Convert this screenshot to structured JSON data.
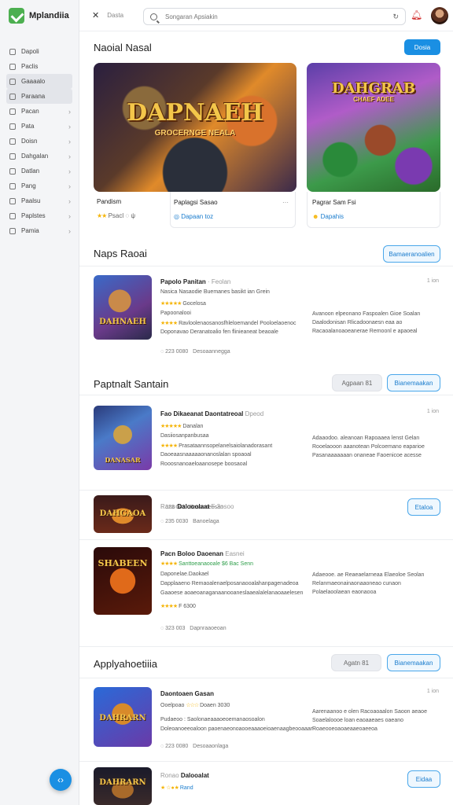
{
  "app": {
    "name": "Mplandiia"
  },
  "sidebar": {
    "items": [
      {
        "label": "Dapoli",
        "chevron": false,
        "active": false
      },
      {
        "label": "Paclis",
        "chevron": false,
        "active": false
      },
      {
        "label": "Gaaaalo",
        "chevron": false,
        "active": true
      },
      {
        "label": "Paraana",
        "chevron": false,
        "active": true
      },
      {
        "label": "Pacan",
        "chevron": true,
        "active": false
      },
      {
        "label": "Pata",
        "chevron": true,
        "active": false
      },
      {
        "label": "Doisn",
        "chevron": true,
        "active": false
      },
      {
        "label": "Dahgalan",
        "chevron": true,
        "active": false
      },
      {
        "label": "Datlan",
        "chevron": true,
        "active": false
      },
      {
        "label": "Pang",
        "chevron": true,
        "active": false
      },
      {
        "label": "Paalsu",
        "chevron": true,
        "active": false
      },
      {
        "label": "Paplstes",
        "chevron": true,
        "active": false
      },
      {
        "label": "Pamia",
        "chevron": true,
        "active": false
      }
    ]
  },
  "topbar": {
    "tab": "Dasta",
    "search_placeholder": "Songaran Apsiakin"
  },
  "featured": {
    "title": "Naoial Nasal",
    "action": "Dosia",
    "cards": [
      {
        "art_title": "DAPNAEH",
        "art_subtitle": "GROCERNGE NEALA",
        "name": "Pandism",
        "sub": "Psacl",
        "more": "ψ",
        "rating": "★★"
      },
      {
        "art_title": "DAHGRAB",
        "art_subtitle": "",
        "name": "Paplagsi Sasao",
        "sub": "Dapaan toz",
        "more": "⋯",
        "rating": ""
      },
      {
        "art_title": "DAHGRAB",
        "art_subtitle": "CHAEF ADEE",
        "name": "Pagrar Sam Fsi",
        "sub": "Dapahis",
        "more": "",
        "rating": ""
      }
    ]
  },
  "section1": {
    "title": "Naps Raoai",
    "action": "Bamaeranoalien",
    "rows": [
      {
        "thumb_title": "DAHNAEH",
        "title": "Papolo Panitan",
        "title_extra": "Feolan",
        "time": "1 ion",
        "tagline": "Nasica Nasaodie Buemanes basikt ian Grein",
        "rating_line": "Gocelosa",
        "sub_line": "Papoonalooi",
        "detail_line": "Ravloolenaosanosfhleloemandel Pooloelaoenoc",
        "detail_line2": "Doponavao Deranatoalio fen flinieaneat beaoale",
        "desc": "Avanoon elpeonano Faspoalen Gioe Soalan Daalodonisan Rlicadoonaesn eaa ao Racaoalanoaoeanerae Remoonl e apaoeal",
        "meta": "223 0080",
        "meta2": "Desoaannegga"
      }
    ]
  },
  "section2": {
    "title": "Paptnalt Santain",
    "action_gray": "Agpaan 81",
    "action": "Bianemaakan",
    "rows": [
      {
        "thumb_title": "DANASAR",
        "title": "Fao Dikaeanat Daontatreoal",
        "title_extra": "Dpeod",
        "time": "1 ion",
        "tagline": "Danalan",
        "rating_line": "Dasiiosanpanbusaa",
        "sub_line": "Prasataannsopelanelsaiolanadorasant",
        "detail_line": "Daoeaasnaaaaaonanoslalan spoaoal",
        "detail_line2": "Rooosnanoaeloaanosepe boosaoal",
        "desc": "Adaaodoo. aleanoan Rapoaaea lenst Gelan Rooelaooon aaanotean Polcoemano eaparioe Pasanaaaaaaan onaneae Faoenicoe acesse",
        "meta": "323 003",
        "meta2": "Bosonoeosan"
      },
      {
        "thumb_title": "DAHGAOA",
        "title": "Dalooolaat",
        "title_prefix": "Rano",
        "title_extra": "F 3osoo",
        "time": "",
        "tagline": "",
        "rating_line": "",
        "sub_line": "",
        "detail_line": "",
        "detail_line2": "",
        "desc": "",
        "meta": "235 0030",
        "meta2": "Banoelaga",
        "action": "Etaloa"
      },
      {
        "thumb_title": "SHABEEN",
        "title": "Pacn Boloo Daoenan",
        "title_extra": "Easnei",
        "time": "",
        "tagline": "Santtoeanaooale $6 Bac Senn",
        "rating_line": "F 6300",
        "sub_line": "Daponelae.Daokael",
        "detail_line": "Dapplaaeno Remaoalenaelposanaooalahanpagenadeoa",
        "detail_line2": "Gaaoese aoaeoanaganaanooaneslaaealalelanaoaaelesen",
        "desc": "Adaeooe. ae Reaeaelarneaa Elaeoloe Seolan Relanmaeonainaonaaoneao cunaon Polaelaoolaean eaonaooa",
        "meta": "323 003",
        "meta2": "Dapnraaoeoan"
      }
    ]
  },
  "section3": {
    "title": "Applyahoetiiia",
    "action_gray": "Agatn 81",
    "action": "Bianemaakan",
    "rows": [
      {
        "thumb_title": "DAHRARN",
        "title": "Daontoaen Gasan",
        "title_extra": "",
        "time": "1 ion",
        "tagline": "Ooelpoao",
        "rating_line": "Doaen 3030",
        "sub_line": "Pudaeoo : Saolonaeaaaoeoemanaosoalon",
        "detail_line": "Doleoanoeeoaloon paoenaeonoaooeaaaoeioaenaagbeooaaan",
        "detail_line2": "",
        "desc": "Aarenaanoo e olen Racoaoaalon Saoon aeaoe Soaelaloooe loan eaoaaeaes oaeano Roaeooeoaoaeaaeoaeeoa",
        "meta": "223 0080",
        "meta2": "Desoaaonlaga"
      },
      {
        "thumb_title": "DAHRARN",
        "title": "Dalooalat",
        "title_prefix": "Ronao",
        "title_extra": "",
        "time": "",
        "tagline": "",
        "rating_line": "Rand",
        "sub_line": "",
        "detail_line": "",
        "detail_line2": "",
        "desc": "",
        "meta": "",
        "meta2": "",
        "action": "Eidaa"
      }
    ]
  }
}
